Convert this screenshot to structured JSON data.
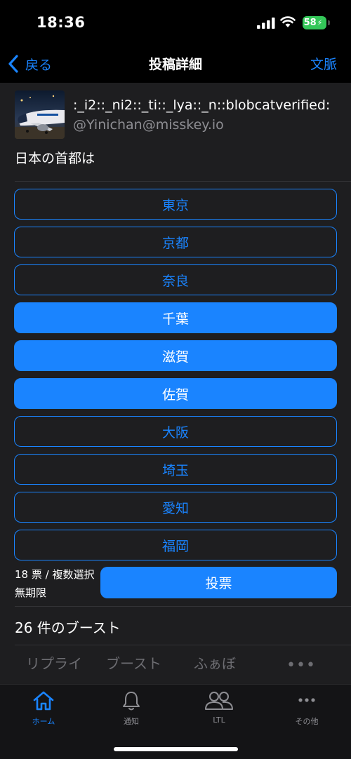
{
  "status_bar": {
    "time": "18:36",
    "battery": "58",
    "icons": [
      "signal-icon",
      "wifi-icon",
      "battery-icon"
    ]
  },
  "nav": {
    "back_label": "戻る",
    "title": "投稿詳細",
    "context_label": "文脈"
  },
  "post": {
    "display_name": ":_i2::_ni2::_ti::_lya::_n::blobcatverified:",
    "username": "@Yinichan@misskey.io",
    "text": "日本の首都は"
  },
  "poll": {
    "options": [
      {
        "label": "東京",
        "selected": false
      },
      {
        "label": "京都",
        "selected": false
      },
      {
        "label": "奈良",
        "selected": false
      },
      {
        "label": "千葉",
        "selected": true
      },
      {
        "label": "滋賀",
        "selected": true
      },
      {
        "label": "佐賀",
        "selected": true
      },
      {
        "label": "大阪",
        "selected": false
      },
      {
        "label": "埼玉",
        "selected": false
      },
      {
        "label": "愛知",
        "selected": false
      },
      {
        "label": "福岡",
        "selected": false
      }
    ],
    "votes_text": "18 票 / 複数選択",
    "expiry_text": "無期限",
    "vote_button_label": "投票"
  },
  "boosts": {
    "count_text": "26 件のブースト"
  },
  "tabs": {
    "reply": "リプライ",
    "boost": "ブースト",
    "fav": "ふぁぼ",
    "more": "•••"
  },
  "tab_bar": {
    "home": "ホーム",
    "notifications": "通知",
    "ltl": "LTL",
    "other": "その他"
  },
  "colors": {
    "accent": "#1a84ff",
    "background": "#1e1e20",
    "bar": "#000000",
    "battery": "#34c759"
  }
}
